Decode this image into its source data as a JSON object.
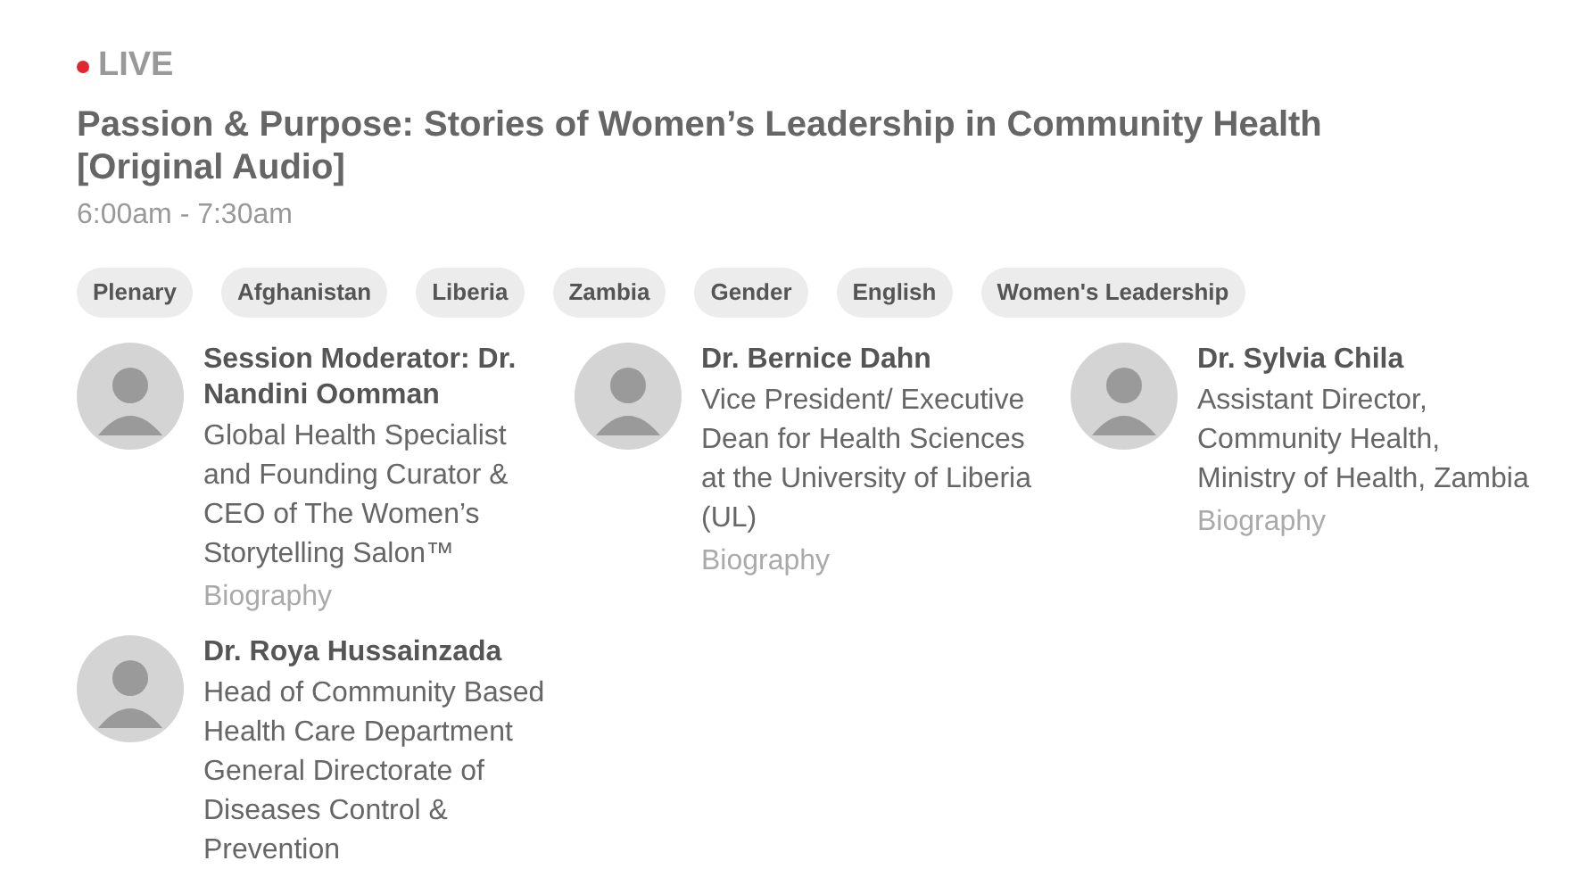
{
  "status": {
    "label": "LIVE",
    "live": true
  },
  "session": {
    "title": "Passion & Purpose: Stories of Women’s Leadership in Community Health [Original Audio]",
    "time": "6:00am - 7:30am"
  },
  "tags": [
    "Plenary",
    "Afghanistan",
    "Liberia",
    "Zambia",
    "Gender",
    "English",
    "Women's Leadership"
  ],
  "speakers": [
    {
      "name": "Session Moderator: Dr. Nandini Oomman",
      "description": "Global Health Specialist and Founding Curator & CEO of The Women’s Storytelling Salon™",
      "link": "Biography"
    },
    {
      "name": "Dr. Bernice Dahn",
      "description": "Vice President/ Executive Dean for Health Sciences at the University of Liberia (UL)",
      "link": "Biography"
    },
    {
      "name": "Dr. Sylvia Chila",
      "description": "Assistant Director, Community Health, Ministry of Health, Zambia",
      "link": "Biography"
    },
    {
      "name": "Dr. Roya Hussainzada",
      "description": "Head of Community Based Health Care Department General Directorate of Diseases Control & Prevention"
    }
  ]
}
